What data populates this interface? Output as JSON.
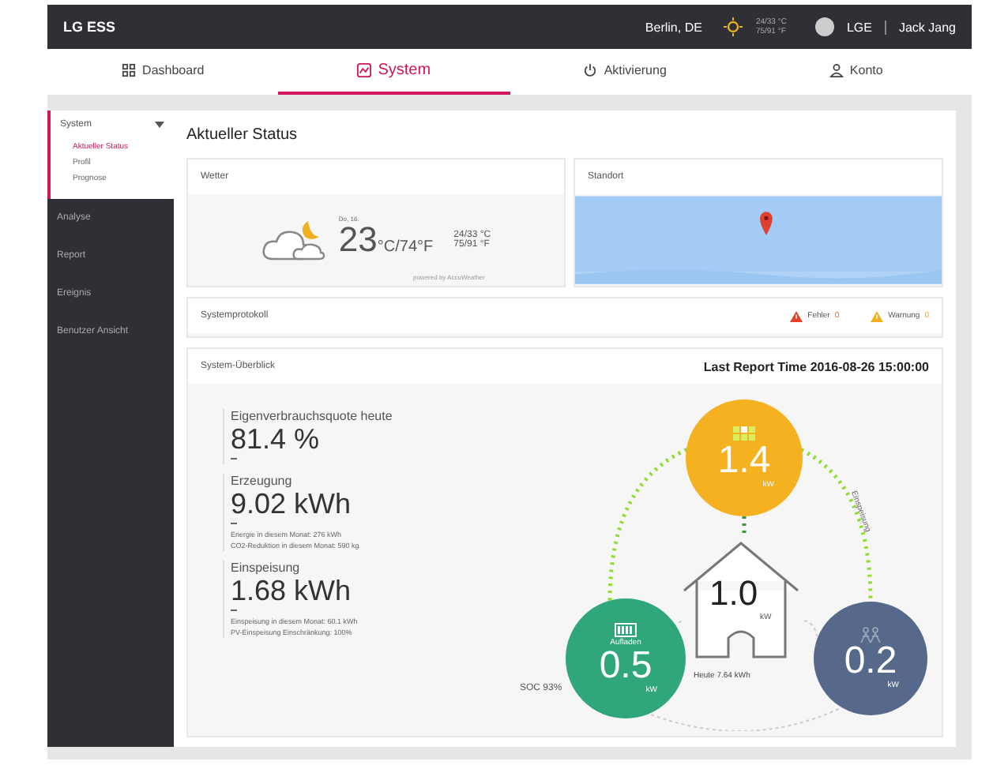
{
  "header": {
    "brand": "LG ESS",
    "location": "Berlin, DE",
    "temps": [
      "24/33 °C",
      "75/91 °F"
    ],
    "company": "LGE",
    "user": "Jack Jang"
  },
  "tabs": [
    {
      "label": "Dashboard",
      "selected": false
    },
    {
      "label": "System",
      "selected": true
    },
    {
      "label": "Aktivierung",
      "selected": false
    },
    {
      "label": "Konto",
      "selected": false
    }
  ],
  "sidebar": {
    "items": [
      {
        "label": "System",
        "expanded": true,
        "selected": true,
        "children": [
          {
            "label": "Aktueller Status",
            "selected": true
          },
          {
            "label": "Profil",
            "selected": false
          },
          {
            "label": "Prognose",
            "selected": false
          }
        ]
      },
      {
        "label": "Analyse",
        "expanded": false,
        "selected": false
      },
      {
        "label": "Report",
        "expanded": false,
        "selected": false
      },
      {
        "label": "Ereignis",
        "expanded": false,
        "selected": false
      },
      {
        "label": "Benutzer Ansicht",
        "expanded": false,
        "selected": false
      }
    ]
  },
  "page_title": "Aktueller Status",
  "weather": {
    "title": "Wetter",
    "day": "Do, 16.",
    "temp": "23",
    "temp_rest": "°C/74°F",
    "range": [
      "24/33 °C",
      "75/91 °F"
    ],
    "credit": "powered by AccuWeather"
  },
  "location": {
    "title": "Standort"
  },
  "log": {
    "title": "Systemprotokoll",
    "counters": [
      {
        "kind": "error",
        "label": "Fehler",
        "count": "0"
      },
      {
        "kind": "warning",
        "label": "Warnung",
        "count": "0"
      }
    ]
  },
  "overview": {
    "title": "System-Überblick",
    "report_time": "Last Report Time 2016-08-26 15:00:00",
    "stats": [
      {
        "label": "Eigenverbrauchsquote heute",
        "value": "81.4 %"
      },
      {
        "label": "Erzeugung",
        "value": "9.02 kWh",
        "notes": [
          "Energie in diesem Monat: 276 kWh",
          "CO2-Reduktion in diesem Monat: 590 kg"
        ]
      },
      {
        "label": "Einspeisung",
        "value": "1.68 kWh",
        "notes": [
          "Einspeisung in diesem Monat: 60.1 kWh",
          "PV-Einspeisung Einschränkung: 100%"
        ]
      }
    ],
    "nodes": [
      {
        "kind": "solar",
        "value": "1.4",
        "unit": "kW",
        "color": "#f5b120"
      },
      {
        "kind": "battery",
        "label": "Aufladen",
        "value": "0.5",
        "unit": "kW",
        "color": "#2fa77a"
      },
      {
        "kind": "grid",
        "value": "0.2",
        "unit": "kW",
        "color": "#56698a"
      }
    ],
    "house": {
      "value": "1.0",
      "unit": "kW",
      "caption": "Heute 7.64 kWh"
    },
    "soc": "SOC 93%",
    "flow_label": "Einspeisung"
  }
}
